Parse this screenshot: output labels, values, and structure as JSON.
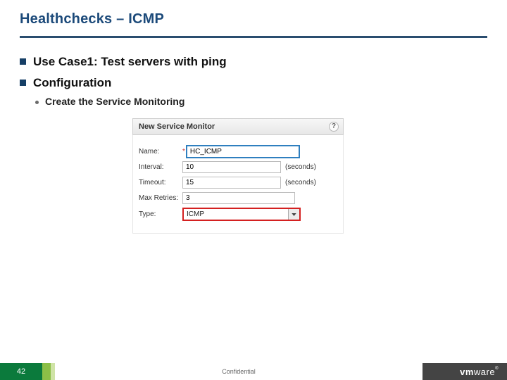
{
  "header": {
    "title": "Healthchecks – ICMP"
  },
  "bullets": {
    "usecase": "Use Case1: Test servers with ping",
    "config": "Configuration",
    "sub": "Create the Service Monitoring"
  },
  "dialog": {
    "title": "New Service Monitor",
    "fields": {
      "name_label": "Name:",
      "name_value": "HC_ICMP",
      "interval_label": "Interval:",
      "interval_value": "10",
      "interval_unit": "(seconds)",
      "timeout_label": "Timeout:",
      "timeout_value": "15",
      "timeout_unit": "(seconds)",
      "retries_label": "Max Retries:",
      "retries_value": "3",
      "type_label": "Type:",
      "type_value": "ICMP"
    }
  },
  "footer": {
    "page": "42",
    "confidential": "Confidential",
    "brand": "vmware",
    "reg": "®"
  }
}
